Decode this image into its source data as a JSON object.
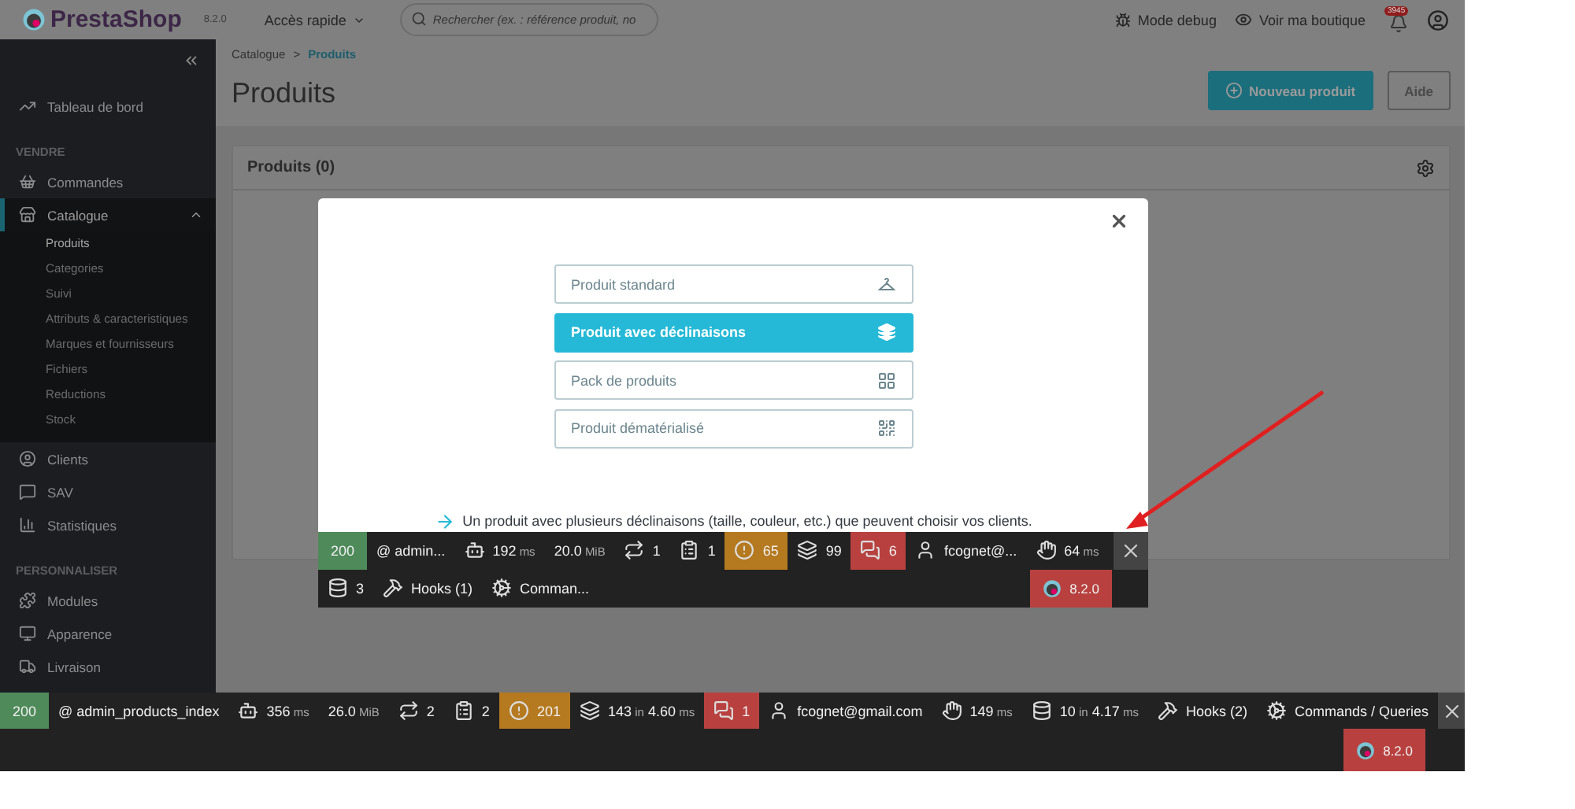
{
  "header": {
    "logo": "PrestaShop",
    "version": "8.2.0",
    "quick_access": "Accès rapide",
    "search": {
      "placeholder": "Rechercher (ex. : référence produit, no"
    },
    "debug": "Mode debug",
    "view_shop": "Voir ma boutique",
    "notifications": "3945"
  },
  "sidebar": {
    "items": [
      {
        "kind": "dashboard",
        "label": "Tableau de bord",
        "selected": false
      },
      {
        "kind": "section",
        "label": "VENDRE"
      },
      {
        "kind": "orders",
        "label": "Commandes",
        "selected": false
      },
      {
        "kind": "catalog",
        "label": "Catalogue",
        "selected": true,
        "expanded": true,
        "children": [
          {
            "label": "Produits",
            "selected": true
          },
          {
            "label": "Categories",
            "selected": false
          },
          {
            "label": "Suivi",
            "selected": false
          },
          {
            "label": "Attributs & caracteristiques",
            "selected": false
          },
          {
            "label": "Marques et fournisseurs",
            "selected": false
          },
          {
            "label": "Fichiers",
            "selected": false
          },
          {
            "label": "Reductions",
            "selected": false
          },
          {
            "label": "Stock",
            "selected": false
          }
        ]
      },
      {
        "kind": "customers",
        "label": "Clients",
        "selected": false
      },
      {
        "kind": "support",
        "label": "SAV",
        "selected": false
      },
      {
        "kind": "stats",
        "label": "Statistiques",
        "selected": false
      },
      {
        "kind": "section",
        "label": "PERSONNALISER"
      },
      {
        "kind": "modules",
        "label": "Modules",
        "selected": false
      },
      {
        "kind": "design",
        "label": "Apparence",
        "selected": false
      },
      {
        "kind": "shipping",
        "label": "Livraison",
        "selected": false
      }
    ]
  },
  "breadcrumb": {
    "items": [
      "Catalogue",
      "Produits"
    ],
    "separator": ">"
  },
  "page_title": "Produits",
  "actions": [
    {
      "kind": "primary",
      "label": "Nouveau produit"
    },
    {
      "kind": "secondary",
      "label": "Aide"
    }
  ],
  "panel": {
    "title": "Produits (0)"
  },
  "modal": {
    "options": [
      {
        "kind": "standard",
        "label": "Produit standard",
        "selected": false
      },
      {
        "kind": "combinations",
        "label": "Produit avec déclinaisons",
        "selected": true
      },
      {
        "kind": "pack",
        "label": "Pack de produits",
        "selected": false
      },
      {
        "kind": "virtual",
        "label": "Produit dématérialisé",
        "selected": false
      }
    ],
    "description": "Un produit avec plusieurs déclinaisons (taille, couleur, etc.) que peuvent choisir vos clients.",
    "toolbar": {
      "items": [
        {
          "kind": "status",
          "text": "200",
          "color": "#4e8a5a"
        },
        {
          "kind": "route",
          "text": "@ admin..."
        },
        {
          "kind": "time",
          "segments": [
            {
              "text": "192",
              "muted": false
            },
            {
              "text": "ms",
              "muted": true
            }
          ]
        },
        {
          "kind": "memory",
          "segments": [
            {
              "text": "20.0",
              "muted": false
            },
            {
              "text": "MiB",
              "muted": true
            }
          ]
        },
        {
          "kind": "ajax",
          "text": "1"
        },
        {
          "kind": "forms",
          "text": "1"
        },
        {
          "kind": "logs",
          "text": "65",
          "color": "#b5791f"
        },
        {
          "kind": "queries",
          "text": "99"
        },
        {
          "kind": "translation",
          "text": "6",
          "color": "#b8413f"
        },
        {
          "kind": "user",
          "text": "fcognet@..."
        },
        {
          "kind": "events",
          "segments": [
            {
              "text": "64",
              "muted": false
            },
            {
              "text": "ms",
              "muted": true
            }
          ]
        }
      ],
      "extra": [
        {
          "kind": "db",
          "text": "3"
        },
        {
          "kind": "hooks",
          "text": "Hooks (1)"
        },
        {
          "kind": "commands",
          "text": "Comman..."
        }
      ],
      "version": "8.2.0"
    }
  },
  "toolbar": {
    "items": [
      {
        "kind": "status",
        "text": "200",
        "color": "#4e8a5a"
      },
      {
        "kind": "route",
        "text": "@ admin_products_index"
      },
      {
        "kind": "time",
        "segments": [
          {
            "text": "356",
            "muted": false
          },
          {
            "text": "ms",
            "muted": true
          }
        ]
      },
      {
        "kind": "memory",
        "segments": [
          {
            "text": "26.0",
            "muted": false
          },
          {
            "text": "MiB",
            "muted": true
          }
        ]
      },
      {
        "kind": "ajax",
        "text": "2"
      },
      {
        "kind": "forms",
        "text": "2"
      },
      {
        "kind": "logs",
        "text": "201",
        "color": "#b5791f"
      },
      {
        "kind": "queries",
        "segments": [
          {
            "text": "143",
            "muted": false
          },
          {
            "text": "in",
            "muted": true
          },
          {
            "text": "4.60",
            "muted": false
          },
          {
            "text": "ms",
            "muted": true
          }
        ]
      },
      {
        "kind": "translation",
        "text": "1",
        "color": "#b8413f"
      },
      {
        "kind": "user",
        "text": "fcognet@gmail.com"
      },
      {
        "kind": "events",
        "segments": [
          {
            "text": "149",
            "muted": false
          },
          {
            "text": "ms",
            "muted": true
          }
        ]
      },
      {
        "kind": "db",
        "segments": [
          {
            "text": "10",
            "muted": false
          },
          {
            "text": "in",
            "muted": true
          },
          {
            "text": "4.17",
            "muted": false
          },
          {
            "text": "ms",
            "muted": true
          }
        ]
      },
      {
        "kind": "hooks",
        "text": "Hooks (2)"
      },
      {
        "kind": "commands",
        "text": "Commands / Queries"
      }
    ],
    "version": "8.2.0"
  }
}
